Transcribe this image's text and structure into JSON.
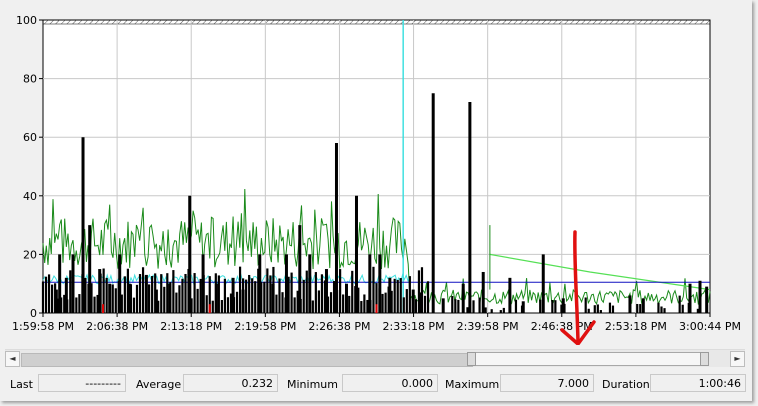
{
  "chart_data": {
    "type": "line",
    "y_ticks": [
      "100",
      "80",
      "60",
      "40",
      "20",
      "0"
    ],
    "ylim": [
      0,
      100
    ],
    "x_ticks": [
      "1:59:58 PM",
      "2:06:38 PM",
      "2:13:18 PM",
      "2:19:58 PM",
      "2:26:38 PM",
      "2:33:18 PM",
      "2:39:58 PM",
      "2:46:38 PM",
      "2:53:18 PM",
      "3:00:44 PM"
    ],
    "grid": true,
    "legend": "none",
    "colors": {
      "plot_bg": "#ffffff",
      "grid": "#c8c8c8",
      "black_series": "#000000",
      "green_series": "#1a8a1a",
      "light_green_series": "#55e055",
      "cyan_series": "#40e0e0",
      "blue_series": "#1010c0",
      "red_series": "#e00000",
      "annotation_arrow": "#e01010"
    },
    "series": [
      {
        "color": "black",
        "spike_values": [
          {
            "x": 0.02,
            "y": 8
          },
          {
            "x": 0.025,
            "y": 20
          },
          {
            "x": 0.035,
            "y": 12
          },
          {
            "x": 0.045,
            "y": 20
          },
          {
            "x": 0.06,
            "y": 60
          },
          {
            "x": 0.07,
            "y": 30
          },
          {
            "x": 0.085,
            "y": 15
          },
          {
            "x": 0.1,
            "y": 10
          },
          {
            "x": 0.115,
            "y": 20
          },
          {
            "x": 0.13,
            "y": 10
          },
          {
            "x": 0.155,
            "y": 13
          },
          {
            "x": 0.17,
            "y": 8
          },
          {
            "x": 0.19,
            "y": 10
          },
          {
            "x": 0.22,
            "y": 40
          },
          {
            "x": 0.24,
            "y": 20
          },
          {
            "x": 0.26,
            "y": 10
          },
          {
            "x": 0.285,
            "y": 12
          },
          {
            "x": 0.3,
            "y": 8
          },
          {
            "x": 0.325,
            "y": 20
          },
          {
            "x": 0.345,
            "y": 10
          },
          {
            "x": 0.365,
            "y": 20
          },
          {
            "x": 0.385,
            "y": 30
          },
          {
            "x": 0.4,
            "y": 20
          },
          {
            "x": 0.425,
            "y": 15
          },
          {
            "x": 0.44,
            "y": 58
          },
          {
            "x": 0.455,
            "y": 10
          },
          {
            "x": 0.47,
            "y": 40
          },
          {
            "x": 0.49,
            "y": 20
          },
          {
            "x": 0.505,
            "y": 20
          },
          {
            "x": 0.52,
            "y": 12
          },
          {
            "x": 0.555,
            "y": 8
          },
          {
            "x": 0.565,
            "y": 7
          },
          {
            "x": 0.585,
            "y": 75
          },
          {
            "x": 0.6,
            "y": 5
          },
          {
            "x": 0.63,
            "y": 10
          },
          {
            "x": 0.64,
            "y": 72
          },
          {
            "x": 0.66,
            "y": 14
          },
          {
            "x": 0.7,
            "y": 12
          },
          {
            "x": 0.72,
            "y": 4
          },
          {
            "x": 0.75,
            "y": 20
          },
          {
            "x": 0.78,
            "y": 5
          },
          {
            "x": 0.88,
            "y": 6
          },
          {
            "x": 0.9,
            "y": 5
          },
          {
            "x": 0.97,
            "y": 10
          },
          {
            "x": 0.985,
            "y": 11
          },
          {
            "x": 0.995,
            "y": 9
          }
        ]
      },
      {
        "color": "cyan",
        "spike": {
          "x": 0.54,
          "y": 100
        },
        "baseline": 11
      },
      {
        "color": "blue",
        "y": 10.5
      },
      {
        "color": "light green",
        "points": [
          {
            "x": 0.67,
            "y": 20
          },
          {
            "x": 0.82,
            "y": 14
          },
          {
            "x": 1.0,
            "y": 8
          }
        ]
      },
      {
        "color": "green",
        "description_values": "noisy 15-45 until 0.55 then 3-8"
      }
    ]
  },
  "scrollbar": {
    "left_arrow": "◄",
    "right_arrow": "►",
    "thumb_start": 0.635,
    "thumb_end": 0.965
  },
  "stats": {
    "last_label": "Last",
    "last_value": "---------",
    "average_label": "Average",
    "average_value": "0.232",
    "minimum_label": "Minimum",
    "minimum_value": "0.000",
    "maximum_label": "Maximum",
    "maximum_value": "7.000",
    "duration_label": "Duration",
    "duration_value": "1:00:46"
  }
}
